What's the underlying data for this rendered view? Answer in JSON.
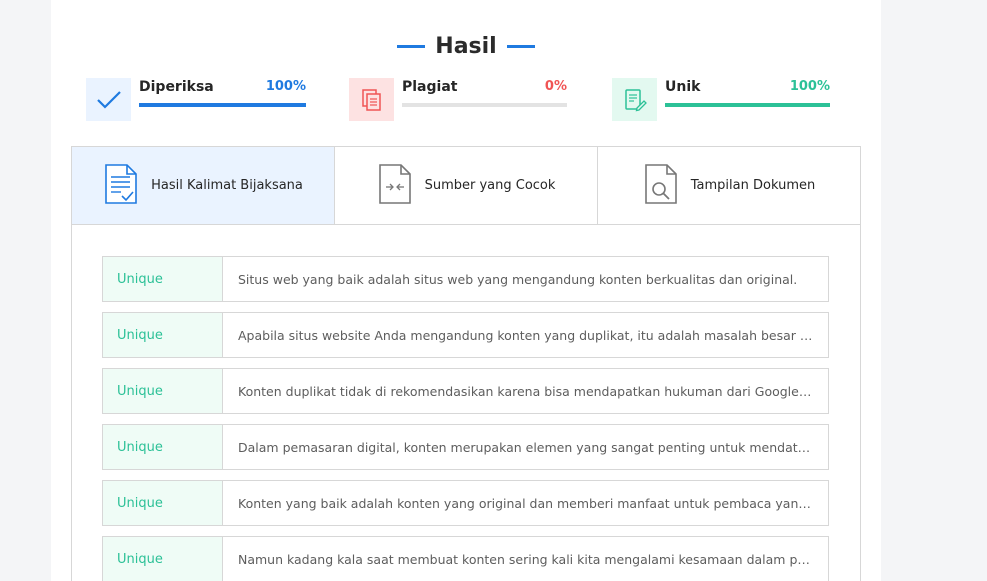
{
  "heading": {
    "title": "Hasil"
  },
  "stats": [
    {
      "label": "Diperiksa",
      "value": "100%",
      "fraction": 1.0,
      "color": "#1f7ae0",
      "icon": "check-icon"
    },
    {
      "label": "Plagiat",
      "value": "0%",
      "fraction": 0.0,
      "color": "#f05454",
      "icon": "copy-document-icon"
    },
    {
      "label": "Unik",
      "value": "100%",
      "fraction": 1.0,
      "color": "#2cc197",
      "icon": "edit-document-icon"
    }
  ],
  "tabs": [
    {
      "label": "Hasil Kalimat Bijaksana",
      "icon": "document-check-icon",
      "active": true
    },
    {
      "label": "Sumber yang Cocok",
      "icon": "document-compare-icon",
      "active": false
    },
    {
      "label": "Tampilan Dokumen",
      "icon": "document-search-icon",
      "active": false
    }
  ],
  "results": [
    {
      "status": "Unique",
      "text": "Situs web yang baik adalah situs web yang mengandung konten berkualitas dan original."
    },
    {
      "status": "Unique",
      "text": "Apabila situs website Anda mengandung konten yang duplikat, itu adalah masalah besar karen..."
    },
    {
      "status": "Unique",
      "text": "Konten duplikat tidak di rekomendasikan karena bisa mendapatkan hukuman dari Google berup..."
    },
    {
      "status": "Unique",
      "text": "Dalam pemasaran digital, konten merupakan elemen yang sangat penting untuk mendatangka..."
    },
    {
      "status": "Unique",
      "text": "Konten yang baik adalah konten yang original dan memberi manfaat untuk pembaca yang pad..."
    },
    {
      "status": "Unique",
      "text": "Namun kadang kala saat membuat konten sering kali kita mengalami kesamaan dalam penulis..."
    }
  ]
}
